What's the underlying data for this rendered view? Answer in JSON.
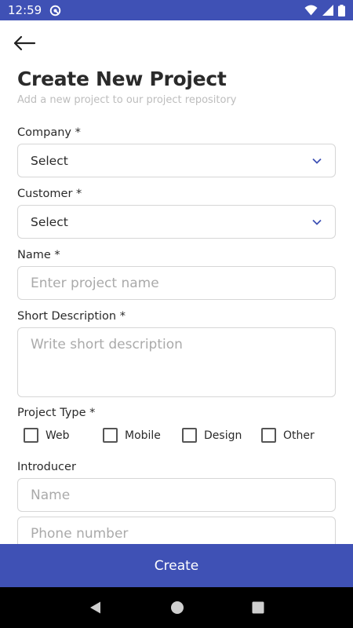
{
  "status_bar": {
    "time": "12:59",
    "colors": {
      "background": "#3f51b5",
      "foreground": "#ffffff"
    },
    "icons": [
      "app-notification-icon",
      "wifi-icon",
      "signal-icon",
      "battery-icon"
    ]
  },
  "header": {
    "back_icon": "back-arrow-icon",
    "title": "Create New Project",
    "subtitle": "Add a new project to our project repository"
  },
  "form": {
    "company": {
      "label": "Company *",
      "value": "Select",
      "icon": "chevron-down-icon"
    },
    "customer": {
      "label": "Customer *",
      "value": "Select",
      "icon": "chevron-down-icon"
    },
    "name": {
      "label": "Name *",
      "placeholder": "Enter project name"
    },
    "short_description": {
      "label": "Short Description *",
      "placeholder": "Write short description"
    },
    "project_type": {
      "label": "Project Type *",
      "options": [
        {
          "label": "Web",
          "checked": false
        },
        {
          "label": "Mobile",
          "checked": false
        },
        {
          "label": "Design",
          "checked": false
        },
        {
          "label": "Other",
          "checked": false
        }
      ]
    },
    "introducer": {
      "label": "Introducer",
      "name_placeholder": "Name",
      "phone_placeholder": "Phone number"
    }
  },
  "actions": {
    "create_label": "Create",
    "accent_color": "#3f51b5"
  },
  "nav_bar": {
    "icons": [
      "nav-back-icon",
      "nav-home-icon",
      "nav-recents-icon"
    ]
  }
}
